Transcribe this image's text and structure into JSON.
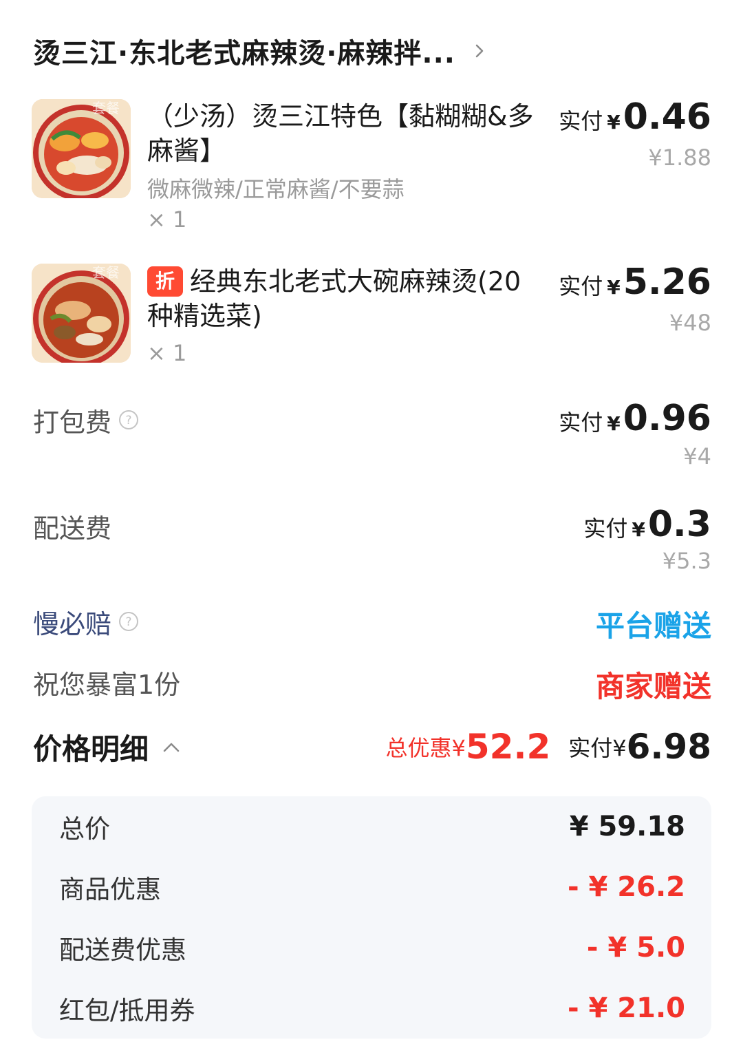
{
  "shop": {
    "name": "烫三江·东北老式麻辣烫·麻辣拌..."
  },
  "items": [
    {
      "title": "（少汤）烫三江特色【黏糊糊&多麻酱】",
      "spec": "微麻微辣/正常麻酱/不要蒜",
      "qty": "× 1",
      "pay_label": "实付",
      "yen": "¥",
      "paid": "0.46",
      "original": "¥1.88",
      "thumb_watermark": "套餐"
    },
    {
      "badge": "折",
      "title": "经典东北老式大碗麻辣烫(20种精选菜)",
      "qty": "× 1",
      "pay_label": "实付",
      "yen": "¥",
      "paid": "5.26",
      "original": "¥48",
      "thumb_watermark": "套餐"
    }
  ],
  "fees": {
    "packing": {
      "label": "打包费",
      "pay_label": "实付",
      "yen": "¥",
      "paid": "0.96",
      "original": "¥4"
    },
    "delivery": {
      "label": "配送费",
      "pay_label": "实付",
      "yen": "¥",
      "paid": "0.3",
      "original": "¥5.3"
    }
  },
  "perks": {
    "slow_comp": {
      "label": "慢必赔",
      "value": "平台赠送"
    },
    "gift": {
      "label": "祝您暴富1份",
      "value": "商家赠送"
    }
  },
  "price_detail": {
    "title": "价格明细",
    "total_saving_label": "总优惠¥",
    "total_saving": "52.2",
    "paid_label": "实付¥",
    "paid": "6.98"
  },
  "breakdown": [
    {
      "label": "总价",
      "value": "¥ 59.18"
    },
    {
      "label": "商品优惠",
      "value": "- ¥ 26.2"
    },
    {
      "label": "配送费优惠",
      "value": "- ¥ 5.0"
    },
    {
      "label": "红包/抵用券",
      "value": "- ¥ 21.0"
    }
  ],
  "colors": {
    "accent_red": "#f2322a",
    "accent_blue": "#1aa3e8",
    "muted": "#9a9a9a",
    "panel_bg": "#f5f7fa"
  }
}
